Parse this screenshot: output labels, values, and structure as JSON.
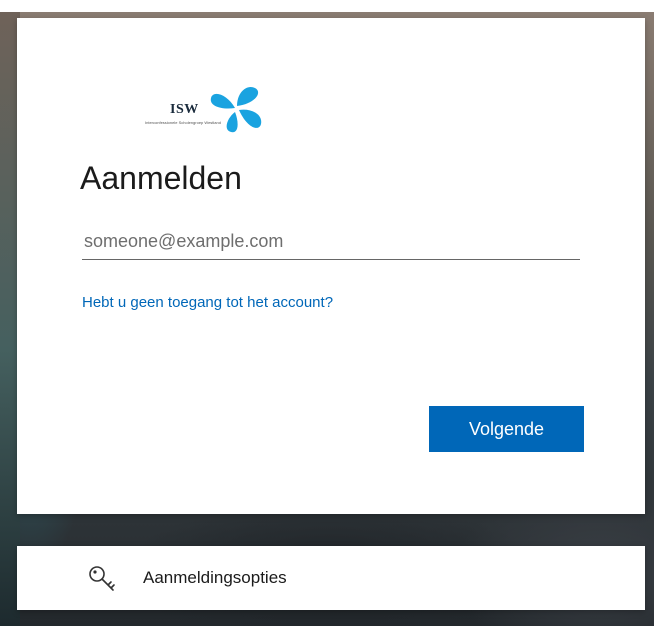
{
  "logo": {
    "name": "ISW",
    "tagline": "Interconfessionele Scholengroep Westland"
  },
  "signin": {
    "title": "Aanmelden",
    "email_placeholder": "someone@example.com",
    "email_value": "",
    "help_link": "Hebt u geen toegang tot het account?",
    "next_label": "Volgende"
  },
  "options": {
    "label": "Aanmeldingsopties",
    "icon": "key-icon"
  },
  "colors": {
    "accent": "#0067b8",
    "logo_blue": "#1aa3e0",
    "text": "#1b1b1b"
  }
}
